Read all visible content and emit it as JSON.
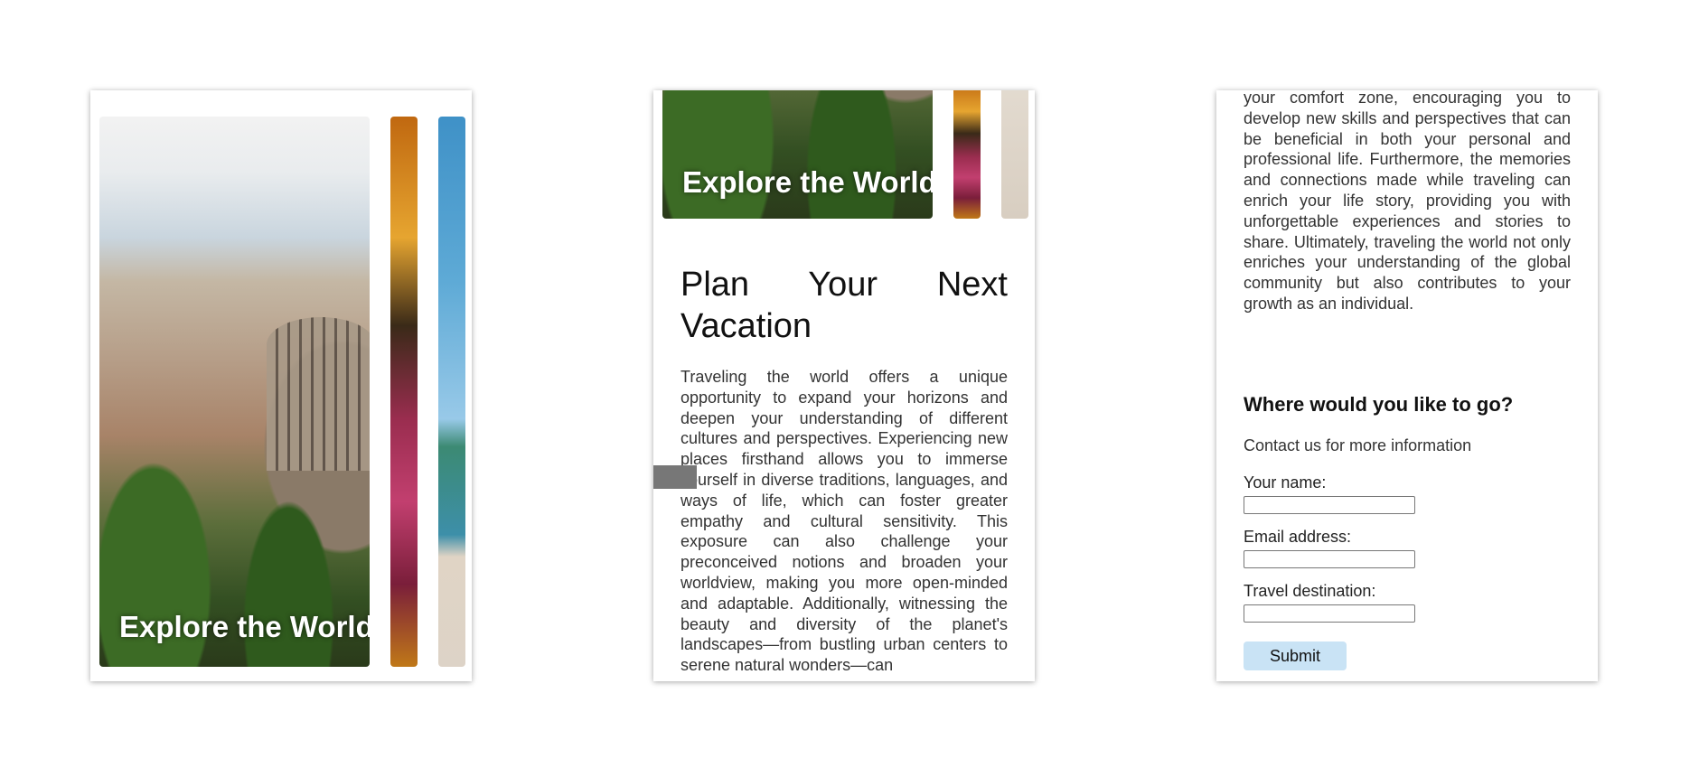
{
  "hero": {
    "caption": "Explore the World"
  },
  "article": {
    "title": "Plan Your Next Vacation",
    "body_part1": "Traveling the world offers a unique opportunity to expand your horizons and deepen your understanding of different cultures and perspectives. Experiencing new places firsthand allows you to immerse yourself in diverse traditions, languages, and ways of life, which can foster greater empathy and cultural sensitivity. This exposure can also challenge your preconceived notions and broaden your worldview, making you more open-minded and adaptable. Additionally, witnessing the beauty and diversity of the planet's landscapes—from bustling urban centers to serene natural wonders—can",
    "body_part2": "your comfort zone, encouraging you to develop new skills and perspectives that can be beneficial in both your personal and professional life. Furthermore, the memories and connections made while traveling can enrich your life story, providing you with unforgettable experiences and stories to share. Ultimately, traveling the world not only enriches your understanding of the global community but also contributes to your growth as an individual."
  },
  "contact_form": {
    "heading": "Where would you like to go?",
    "subheading": "Contact us for more information",
    "name_label": "Your name:",
    "email_label": "Email address:",
    "destination_label": "Travel destination:",
    "submit_label": "Submit"
  },
  "colors": {
    "submit_bg": "#c9e3f5",
    "frame_bg": "#ffffff",
    "scroll_marker": "#777777"
  }
}
